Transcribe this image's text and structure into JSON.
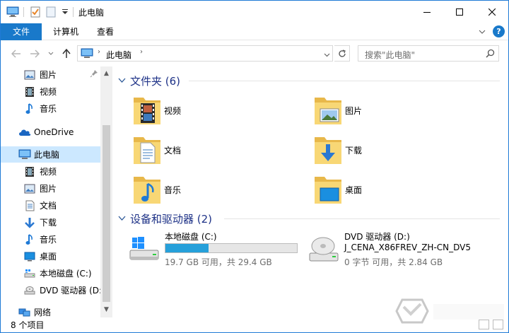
{
  "window": {
    "title": "此电脑"
  },
  "ribbon": {
    "tabs": [
      "文件",
      "计算机",
      "查看"
    ]
  },
  "address": {
    "path": "此电脑"
  },
  "search": {
    "placeholder": "搜索\"此电脑\""
  },
  "nav": {
    "items": [
      {
        "label": "图片",
        "icon": "pictures-icon",
        "pinned": true
      },
      {
        "label": "视频",
        "icon": "videos-icon"
      },
      {
        "label": "音乐",
        "icon": "music-icon"
      },
      {
        "label": "OneDrive",
        "icon": "onedrive-cloud-icon"
      },
      {
        "label": "此电脑",
        "icon": "this-pc-icon",
        "selected": true
      },
      {
        "label": "视频",
        "icon": "videos-icon"
      },
      {
        "label": "图片",
        "icon": "pictures-icon"
      },
      {
        "label": "文档",
        "icon": "documents-icon"
      },
      {
        "label": "下载",
        "icon": "downloads-icon"
      },
      {
        "label": "音乐",
        "icon": "music-icon"
      },
      {
        "label": "桌面",
        "icon": "desktop-icon"
      },
      {
        "label": "本地磁盘 (C:)",
        "icon": "local-disk-icon"
      },
      {
        "label": "DVD 驱动器 (D:",
        "icon": "dvd-drive-icon"
      },
      {
        "label": "网络",
        "icon": "network-icon"
      }
    ]
  },
  "folders": {
    "header": "文件夹 (6)",
    "items": [
      {
        "label": "视频",
        "overlay": "film"
      },
      {
        "label": "图片",
        "overlay": "picture"
      },
      {
        "label": "文档",
        "overlay": "document"
      },
      {
        "label": "下载",
        "overlay": "arrow"
      },
      {
        "label": "音乐",
        "overlay": "note"
      },
      {
        "label": "桌面",
        "overlay": "screen"
      }
    ]
  },
  "devices": {
    "header": "设备和驱动器 (2)",
    "items": [
      {
        "name": "本地磁盘 (C:)",
        "usage": 0.33,
        "space": "19.7 GB 可用，共 29.4 GB",
        "icon": "windows-drive-icon"
      },
      {
        "name": "DVD 驱动器 (D:)",
        "label": "J_CENA_X86FREV_ZH-CN_DV5",
        "space": "0 字节 可用，共 2.84 GB",
        "icon": "dvd-disc-icon"
      }
    ]
  },
  "status": {
    "count": "8 个项目"
  },
  "colors": {
    "accent": "#1979ca",
    "selection": "#cce8ff",
    "folder": "#f8d775",
    "progress": "#26a0da",
    "header_text": "#1e3287"
  }
}
